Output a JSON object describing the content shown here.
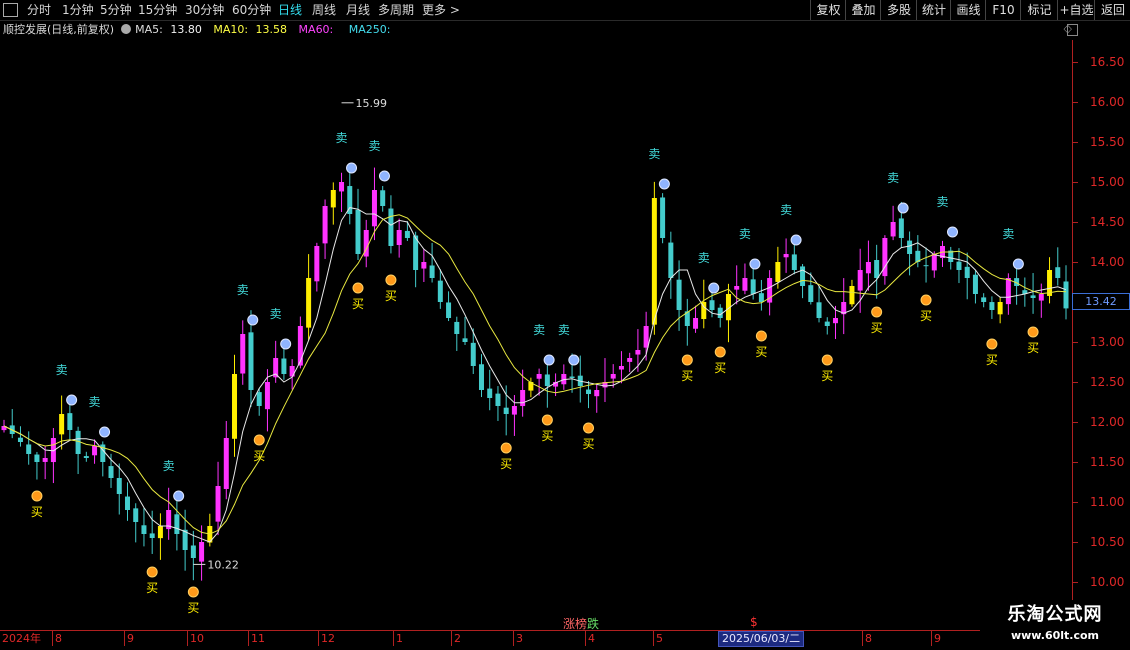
{
  "toolbar": {
    "periods": [
      "分时",
      "1分钟",
      "5分钟",
      "15分钟",
      "30分钟",
      "60分钟",
      "日线",
      "周线",
      "月线",
      "多周期"
    ],
    "active_period": "日线",
    "more_label": "更多 >",
    "tools": [
      "复权",
      "叠加",
      "多股",
      "统计",
      "画线",
      "F10",
      "标记",
      "+自选",
      "返回"
    ]
  },
  "info": {
    "stock_name": "顺控发展(日线,前复权)",
    "ma5_label": "MA5:",
    "ma5_value": "13.80",
    "ma10_label": "MA10:",
    "ma10_value": "13.58",
    "ma60_label": "MA60:",
    "ma60_value": "",
    "ma250_label": "MA250:",
    "ma250_value": ""
  },
  "price_axis": {
    "ticks": [
      "16.50",
      "16.00",
      "15.50",
      "15.00",
      "14.50",
      "14.00",
      "13.50",
      "13.00",
      "12.50",
      "12.00",
      "11.50",
      "11.00",
      "10.50",
      "10.00"
    ],
    "current_price": "13.42"
  },
  "date_axis": {
    "year": "2024年",
    "months": [
      "8",
      "9",
      "10",
      "11",
      "12",
      "1",
      "2",
      "3",
      "4",
      "5",
      "6",
      "7",
      "8",
      "9"
    ],
    "cursor_date": "2025/06/03/二"
  },
  "markers": {
    "rank": [
      "涨",
      "榜",
      "跌"
    ],
    "dollar": "$"
  },
  "annotations": {
    "high_label": "15.99",
    "low_label": "10.22",
    "buy_text": "买",
    "sell_text": "卖"
  },
  "watermark": {
    "title": "乐淘公式网",
    "url": "www.60lt.com"
  },
  "colors": {
    "up": "#ff33ff",
    "down": "#44cccc",
    "signal_up": "#ffee00",
    "ma_white": "#e8e8e8",
    "ma_yellow": "#e8e840",
    "axis": "#e02828"
  },
  "chart_data": {
    "type": "candlestick",
    "ylim": [
      10.0,
      16.5
    ],
    "indicators": [
      "MA5",
      "MA10"
    ],
    "ma5_last": 13.8,
    "ma10_last": 13.58,
    "period_high": 15.99,
    "period_low": 10.22,
    "last_close": 13.42,
    "months": [
      "8",
      "9",
      "10",
      "11",
      "12",
      "1",
      "2",
      "3",
      "4",
      "5",
      "6",
      "7",
      "8",
      "9"
    ],
    "close_series": [
      11.95,
      11.85,
      11.75,
      11.6,
      11.5,
      11.55,
      11.8,
      12.1,
      11.9,
      11.6,
      11.55,
      11.7,
      11.5,
      11.3,
      11.1,
      10.9,
      10.75,
      10.6,
      10.55,
      10.7,
      10.9,
      10.6,
      10.4,
      10.3,
      10.5,
      10.7,
      11.2,
      11.8,
      12.6,
      13.1,
      12.4,
      12.2,
      12.5,
      12.8,
      12.6,
      12.7,
      13.2,
      13.8,
      14.2,
      14.7,
      14.9,
      15.0,
      14.6,
      14.1,
      14.4,
      14.9,
      14.7,
      14.2,
      14.4,
      14.3,
      13.9,
      14.0,
      13.8,
      13.5,
      13.3,
      13.1,
      13.0,
      12.7,
      12.4,
      12.3,
      12.2,
      12.1,
      12.2,
      12.4,
      12.5,
      12.6,
      12.45,
      12.5,
      12.6,
      12.55,
      12.45,
      12.35,
      12.4,
      12.5,
      12.6,
      12.7,
      12.8,
      12.9,
      13.2,
      14.8,
      14.3,
      13.8,
      13.4,
      13.2,
      13.3,
      13.5,
      13.4,
      13.3,
      13.6,
      13.7,
      13.8,
      13.6,
      13.5,
      13.8,
      14.0,
      14.1,
      13.9,
      13.7,
      13.5,
      13.3,
      13.2,
      13.3,
      13.5,
      13.7,
      13.9,
      14.0,
      13.8,
      14.3,
      14.5,
      14.3,
      14.1,
      14.0,
      13.95,
      14.1,
      14.2,
      14.0,
      13.9,
      13.8,
      13.6,
      13.5,
      13.4,
      13.5,
      13.8,
      13.7,
      13.6,
      13.55,
      13.6,
      13.9,
      13.8,
      13.42
    ]
  }
}
